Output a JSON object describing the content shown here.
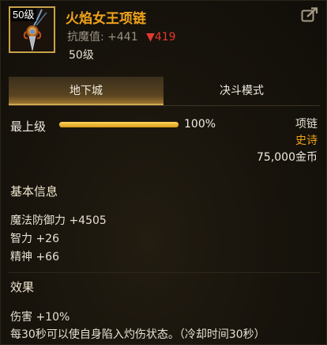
{
  "item": {
    "level_tag": "50级",
    "name": "火焰女王项链",
    "stat_label": "抗魔值:",
    "stat_value": "+441",
    "stat_diff": "▼419",
    "level": "50级",
    "type": "项链",
    "rarity": "史诗",
    "price": "75,000金币"
  },
  "tabs": [
    {
      "label": "地下城",
      "active": true
    },
    {
      "label": "决斗模式",
      "active": false
    }
  ],
  "grade": {
    "label": "最上级",
    "percent": 100,
    "percent_text": "100%"
  },
  "basic": {
    "title": "基本信息",
    "lines": [
      "魔法防御力 +4505",
      "智力 +26",
      "精神 +66"
    ]
  },
  "effect": {
    "title": "效果",
    "lines": [
      "伤害 +10%",
      "每30秒可以使自身陷入灼伤状态。（冷却时间30秒）"
    ]
  },
  "colors": {
    "accent": "#f0a21a",
    "down": "#e23a2e",
    "frame": "#c9a24a"
  },
  "icons": {
    "share": "share-icon",
    "item": "necklace-icon"
  }
}
